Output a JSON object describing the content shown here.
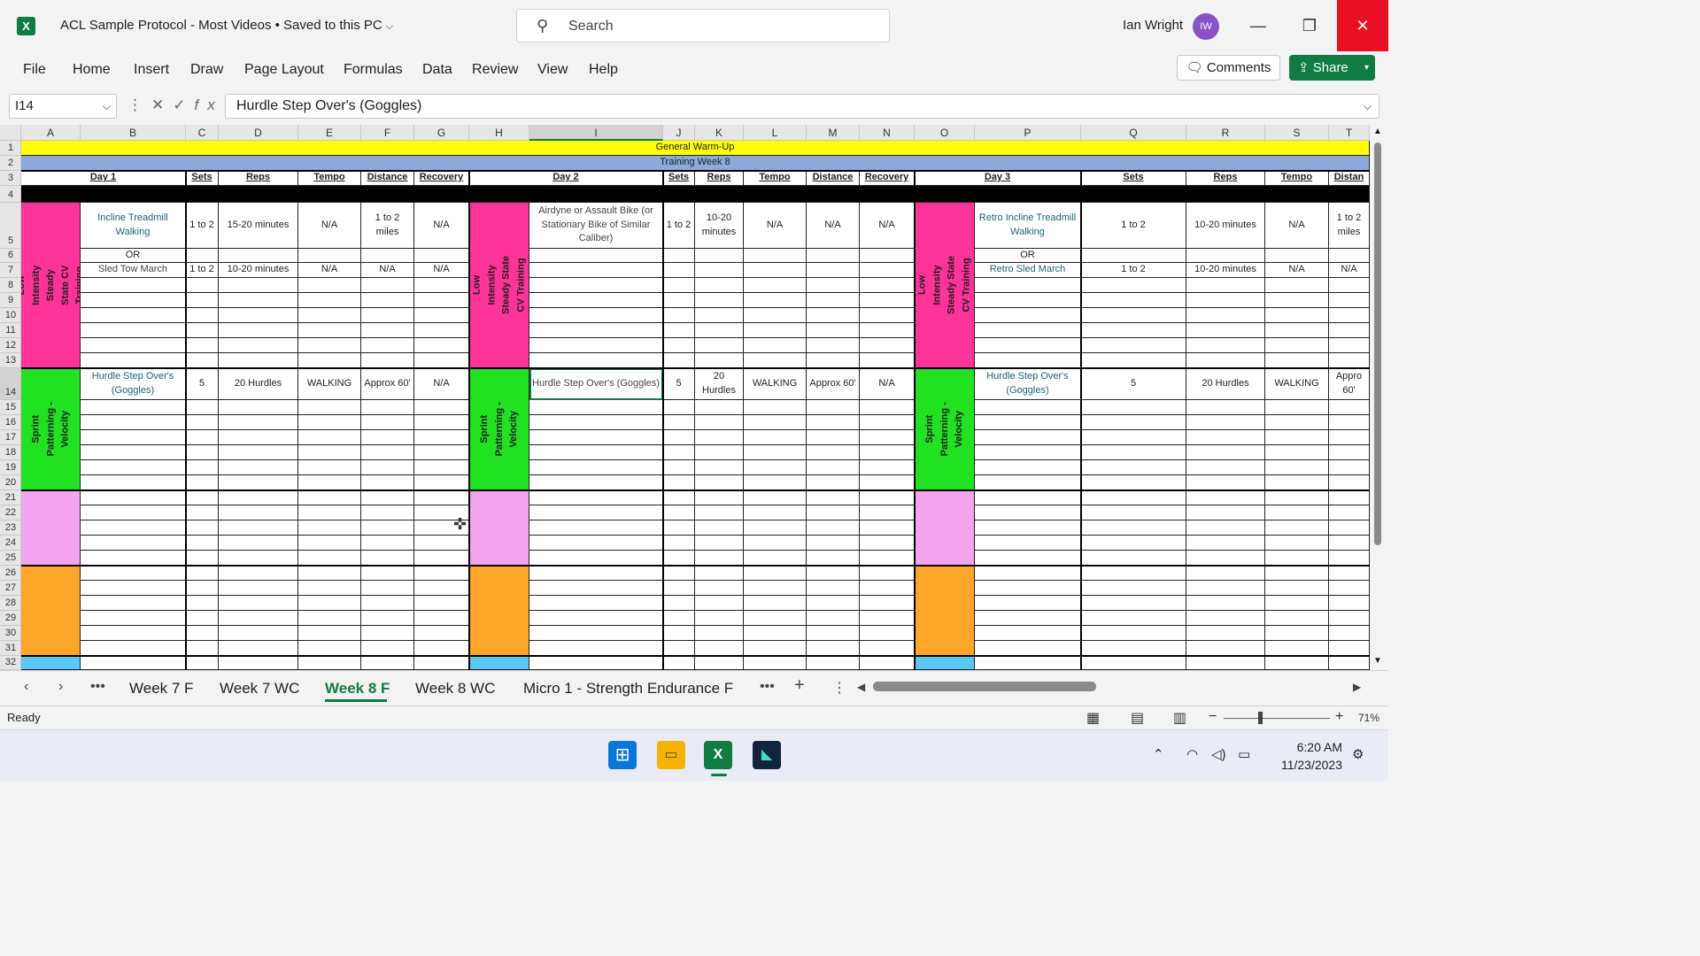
{
  "window": {
    "title": "ACL Sample Protocol - Most Videos • Saved to this PC",
    "search_placeholder": "Search",
    "user_name": "Ian Wright",
    "user_initials": "IW"
  },
  "menu": [
    "File",
    "Home",
    "Insert",
    "Draw",
    "Page Layout",
    "Formulas",
    "Data",
    "Review",
    "View",
    "Help"
  ],
  "actions": {
    "comments": "Comments",
    "share": "Share"
  },
  "formula_bar": {
    "name_box": "I14",
    "formula": "Hurdle Step Over's (Goggles)"
  },
  "columns": [
    "A",
    "B",
    "C",
    "D",
    "E",
    "F",
    "G",
    "H",
    "I",
    "J",
    "K",
    "L",
    "M",
    "N",
    "O",
    "P",
    "Q",
    "R",
    "S",
    "T"
  ],
  "rows": [
    "1",
    "2",
    "3",
    "4",
    "5",
    "6",
    "7",
    "8",
    "9",
    "10",
    "11",
    "12",
    "13",
    "14",
    "15",
    "16",
    "17",
    "18",
    "19",
    "20",
    "21",
    "22",
    "23",
    "24",
    "25",
    "26",
    "27",
    "28",
    "29",
    "30",
    "31",
    "32"
  ],
  "sheet": {
    "banner_warmup": "General Warm-Up",
    "banner_week": "Training Week 8",
    "day1": "Day 1",
    "day2": "Day 2",
    "day3": "Day 3",
    "h_sets": "Sets",
    "h_reps": "Reps",
    "h_tempo": "Tempo",
    "h_distance": "Distance",
    "h_recovery": "Recovery",
    "h_distance_t": "Distan",
    "section_cv": "Low Intensity Steady State CV Training",
    "section_sprint": "Sprint Patterning - Velocity",
    "d1_r5_ex": "Incline Treadmill Walking",
    "d1_r5_sets": "1 to 2",
    "d1_r5_reps": "15-20 minutes",
    "d1_r5_tempo": "N/A",
    "d1_r5_dist": "1 to 2 miles",
    "d1_r5_rec": "N/A",
    "or": "OR",
    "d1_r7_ex": "Sled Tow March",
    "d1_r7_sets": "1 to 2",
    "d1_r7_reps": "10-20 minutes",
    "d1_r7_tempo": "N/A",
    "d1_r7_dist": "N/A",
    "d1_r7_rec": "N/A",
    "d2_r5_ex": "Airdyne or Assault Bike (or Stationary Bike of Similar Caliber)",
    "d2_r5_sets": "1 to 2",
    "d2_r5_reps": "10-20 minutes",
    "d2_r5_tempo": "N/A",
    "d2_r5_dist": "N/A",
    "d2_r5_rec": "N/A",
    "d3_r5_ex": "Retro Incline Treadmill Walking",
    "d3_r5_sets": "1 to 2",
    "d3_r5_reps": "10-20 minutes",
    "d3_r5_tempo": "N/A",
    "d3_r5_dist": "1 to 2 miles",
    "d3_r7_ex": "Retro Sled March",
    "d3_r7_sets": "1 to 2",
    "d3_r7_reps": "10-20 minutes",
    "d3_r7_tempo": "N/A",
    "d3_r7_dist": "N/A",
    "hurdle_ex": "Hurdle Step Over's (Goggles)",
    "hurdle_sets": "5",
    "hurdle_reps": "20 Hurdles",
    "hurdle_tempo": "WALKING",
    "hurdle_dist": "Approx 60'",
    "hurdle_rec": "N/A",
    "d3_hurdle_dist": "Appro 60'"
  },
  "tabs": [
    "Week 7 F",
    "Week 7 WC",
    "Week 8 F",
    "Week 8 WC",
    "Micro 1 - Strength Endurance F"
  ],
  "active_tab": "Week 8 F",
  "status": {
    "ready": "Ready",
    "zoom": "71%"
  },
  "clock": {
    "time": "6:20 AM",
    "date": "11/23/2023"
  },
  "colors": {
    "excel_green": "#107c41",
    "yellow": "#ffff00",
    "blue_band": "#8eaadb",
    "magenta": "#ff3399",
    "green": "#22e022",
    "pink": "#f2a5ee",
    "orange": "#ffa52a",
    "light_blue": "#5bc8f5"
  }
}
